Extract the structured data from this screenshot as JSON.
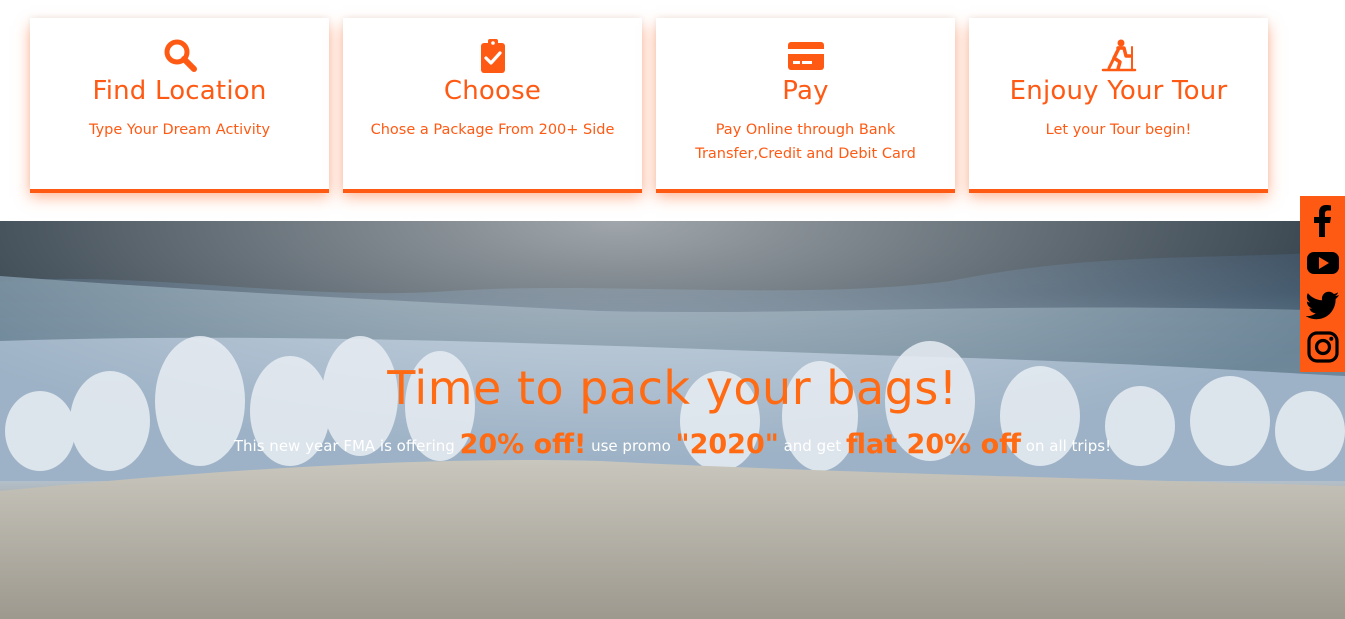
{
  "steps": [
    {
      "icon": "search-icon",
      "title": "Find Location",
      "desc": "Type Your Dream Activity"
    },
    {
      "icon": "clipboard-check-icon",
      "title": "Choose",
      "desc": "Chose a Package From 200+ Side"
    },
    {
      "icon": "credit-card-icon",
      "title": "Pay",
      "desc": "Pay Online through Bank Transfer,Credit and Debit Card"
    },
    {
      "icon": "skiing-icon",
      "title": "Enjouy Your Tour",
      "desc": "Let your Tour begin!"
    }
  ],
  "hero": {
    "title": "Time to pack your bags!",
    "sub_1": "This new year FMA is offering",
    "hl_1": "20% off!",
    "sub_2": "use promo",
    "hl_2": "\"2020\"",
    "sub_3": "and get",
    "hl_3": "flat 20% off",
    "sub_4": "on all trips!"
  },
  "social": [
    "facebook-icon",
    "youtube-icon",
    "twitter-icon",
    "instagram-icon"
  ],
  "colors": {
    "accent": "#ff5a14",
    "hero_title": "#ff6a12"
  }
}
